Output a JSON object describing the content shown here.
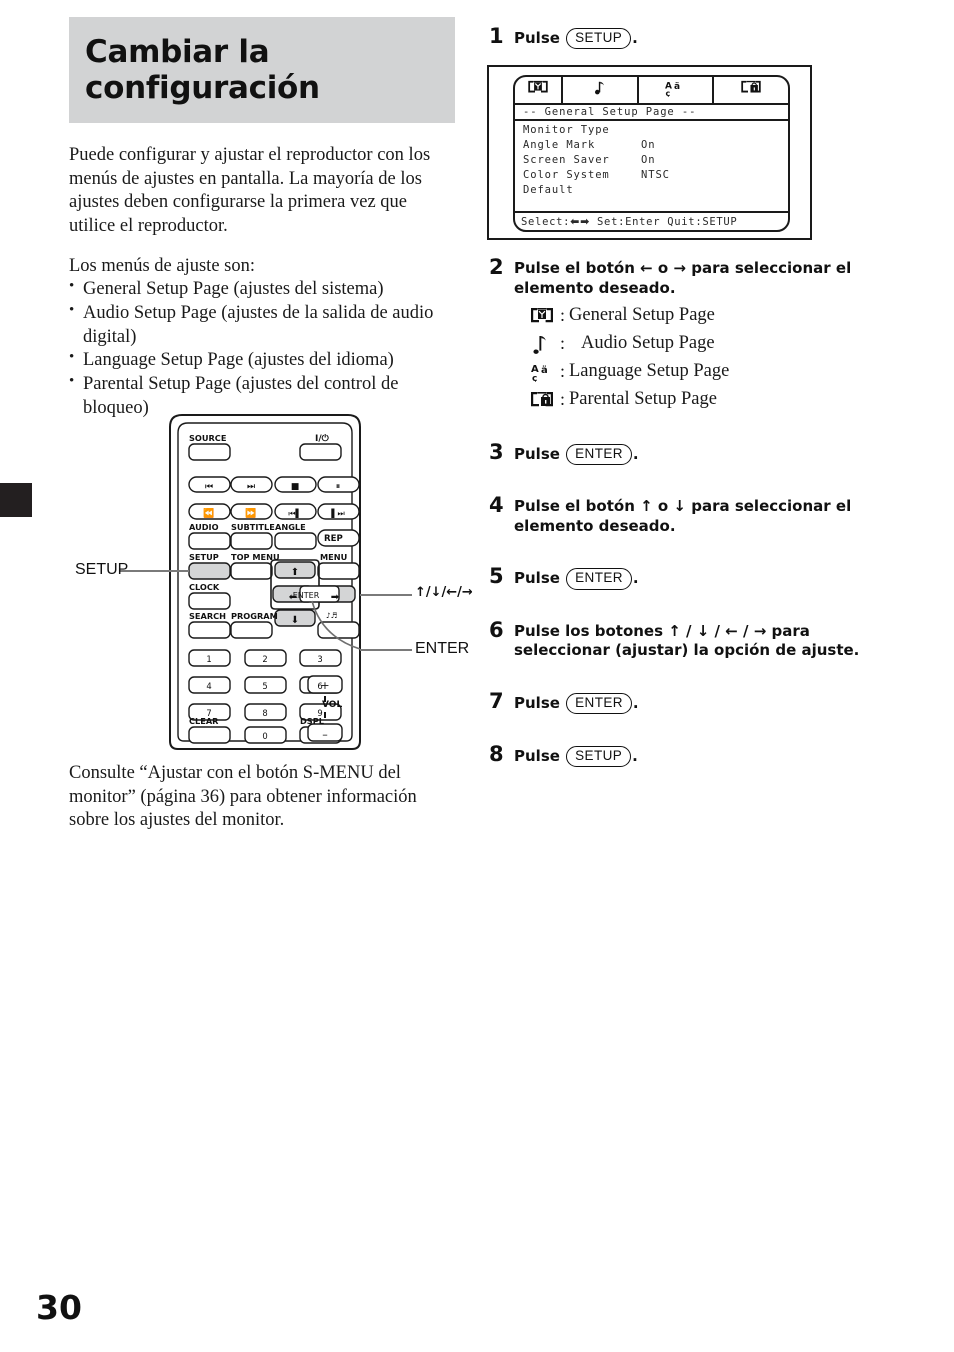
{
  "page": {
    "number": "30",
    "title": "Cambiar la\nconfiguración",
    "title_line1": "Cambiar la",
    "title_line2": "configuración"
  },
  "intro": {
    "paragraph1": "Puede configurar y ajustar el reproductor con los menús de ajustes en pantalla. La mayoría de los ajustes deben configurarse la primera vez que utilice el reproductor.",
    "paragraph2": "Los menús de ajuste son:",
    "menu_items": [
      "General Setup Page (ajustes del sistema)",
      "Audio Setup Page (ajustes de la salida de audio digital)",
      "Language Setup Page (ajustes del idioma)",
      "Parental Setup Page (ajustes del control de bloqueo)"
    ]
  },
  "remote": {
    "callouts": {
      "setup": "SETUP",
      "arrows": "↑/↓/←/→",
      "enter": "ENTER"
    },
    "labels": {
      "source": "SOURCE",
      "power": "I/⏻",
      "audio": "AUDIO",
      "subtitle": "SUBTITLE",
      "angle": "ANGLE",
      "rep": "REP",
      "setup": "SETUP",
      "top_menu": "TOP MENU",
      "menu": "MENU",
      "clock": "CLOCK",
      "enter": "ENTER",
      "search": "SEARCH",
      "program": "PROGRAM",
      "clear": "CLEAR",
      "dspl": "DSPL",
      "vol": "VOL",
      "vol_plus": "+",
      "vol_minus": "–"
    },
    "numeric_keys": [
      "1",
      "2",
      "3",
      "4",
      "5",
      "6",
      "7",
      "8",
      "9",
      "0"
    ]
  },
  "footer_note": "Consulte “Ajustar con el botón S-MENU del monitor” (página 36) para obtener información sobre los ajustes del monitor.",
  "osd": {
    "title": "-- General Setup Page --",
    "footer": "Select:←→ Set:Enter Quit:SETUP",
    "footer_prefix": "Select:",
    "footer_suffix": " Set:Enter Quit:SETUP",
    "tabs": [
      {
        "icon": "monitor-tv-icon",
        "selected": true
      },
      {
        "icon": "music-note-icon",
        "selected": false
      },
      {
        "icon": "language-aca-icon",
        "selected": false
      },
      {
        "icon": "monitor-lock-icon",
        "selected": false
      }
    ],
    "rows": [
      {
        "key": "Monitor Type",
        "value": ""
      },
      {
        "key": "Angle Mark",
        "value": "On"
      },
      {
        "key": "Screen Saver",
        "value": "On"
      },
      {
        "key": "Color System",
        "value": "NTSC"
      },
      {
        "key": "Default",
        "value": ""
      }
    ]
  },
  "steps": [
    {
      "num": "1",
      "prefix": "Pulse ",
      "key": "SETUP",
      "suffix": "."
    },
    {
      "num": "2",
      "text_part1": "Pulse el botón ",
      "arrow1": "←",
      "text_part2": " o ",
      "arrow2": "→",
      "text_part3": " para seleccionar el elemento deseado.",
      "legend": [
        {
          "icon": "monitor-tv-icon",
          "colon": ":",
          "label": "General Setup Page"
        },
        {
          "icon": "music-note-icon",
          "colon": ":",
          "label": "Audio Setup Page"
        },
        {
          "icon": "language-aca-icon",
          "colon": ":",
          "label": "Language Setup Page"
        },
        {
          "icon": "monitor-lock-icon",
          "colon": ":",
          "label": "Parental Setup Page"
        }
      ]
    },
    {
      "num": "3",
      "prefix": "Pulse ",
      "key": "ENTER",
      "suffix": "."
    },
    {
      "num": "4",
      "text_part1": "Pulse el botón ",
      "arrow1": "↑",
      "text_part2": " o ",
      "arrow2": "↓",
      "text_part3": " para seleccionar el elemento deseado."
    },
    {
      "num": "5",
      "prefix": "Pulse ",
      "key": "ENTER",
      "suffix": "."
    },
    {
      "num": "6",
      "text_part1": "Pulse los botones ",
      "arrows": "↑ / ↓ / ← / →",
      "text_part3": " para seleccionar (ajustar) la opción de ajuste."
    },
    {
      "num": "7",
      "prefix": "Pulse ",
      "key": "ENTER",
      "suffix": "."
    },
    {
      "num": "8",
      "prefix": "Pulse ",
      "key": "SETUP",
      "suffix": "."
    }
  ]
}
